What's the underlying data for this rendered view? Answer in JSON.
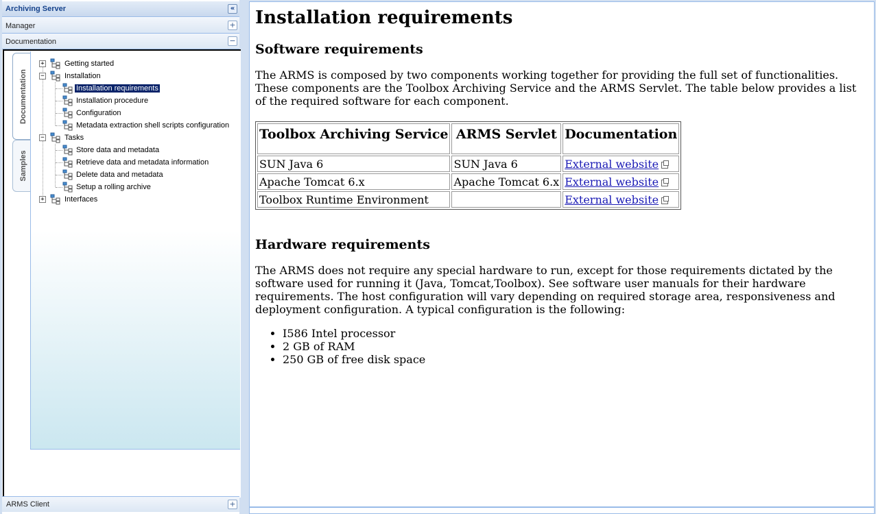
{
  "left_panel": {
    "title": "Archiving Server",
    "accordion": [
      {
        "label": "Manager",
        "tool": "+"
      },
      {
        "label": "Documentation",
        "tool": "−"
      }
    ],
    "vertical_tabs": [
      "Documentation",
      "Samples"
    ],
    "tree": [
      {
        "label": "Getting started",
        "expander": "+"
      },
      {
        "label": "Installation",
        "expander": "−"
      },
      {
        "label": "Installation requirements",
        "selected": true
      },
      {
        "label": "Installation procedure"
      },
      {
        "label": "Configuration"
      },
      {
        "label": "Metadata extraction shell scripts configuration"
      },
      {
        "label": "Tasks",
        "expander": "−"
      },
      {
        "label": "Store data and metadata"
      },
      {
        "label": "Retrieve data and metadata information"
      },
      {
        "label": "Delete data and metadata"
      },
      {
        "label": "Setup a rolling archive"
      },
      {
        "label": "Interfaces",
        "expander": "+"
      }
    ],
    "client_header": {
      "label": "ARMS Client",
      "tool": "+"
    }
  },
  "doc": {
    "title": "Installation requirements",
    "software_heading": "Software requirements",
    "software_text": "The ARMS is composed by two components working together for providing the full set of functionalities. These components are the Toolbox Archiving Service and the ARMS Servlet. The table below provides a list of the required software for each component.",
    "table": {
      "headers": [
        "Toolbox Archiving Service",
        "ARMS Servlet",
        "Documentation"
      ],
      "rows": [
        [
          "SUN Java 6",
          "SUN Java 6",
          "External website"
        ],
        [
          "Apache Tomcat 6.x",
          "Apache Tomcat 6.x",
          "External website"
        ],
        [
          "Toolbox Runtime Environment",
          "",
          "External website"
        ]
      ]
    },
    "hardware_heading": "Hardware requirements",
    "hardware_text": "The ARMS does not require any special hardware to run, except for those requirements dictated by the software used for running it (Java, Tomcat,Toolbox). See software user manuals for their hardware requirements. The host configuration will vary depending on required storage area, responsiveness and deployment configuration. A typical configuration is the following:",
    "hardware_list": [
      "I586 Intel processor",
      "2 GB of RAM",
      "250 GB of free disk space"
    ]
  },
  "colors": {
    "header_text": "#15428b",
    "selection": "#0a246a",
    "link": "#1a1ab5",
    "frame": "#d1dff1"
  }
}
